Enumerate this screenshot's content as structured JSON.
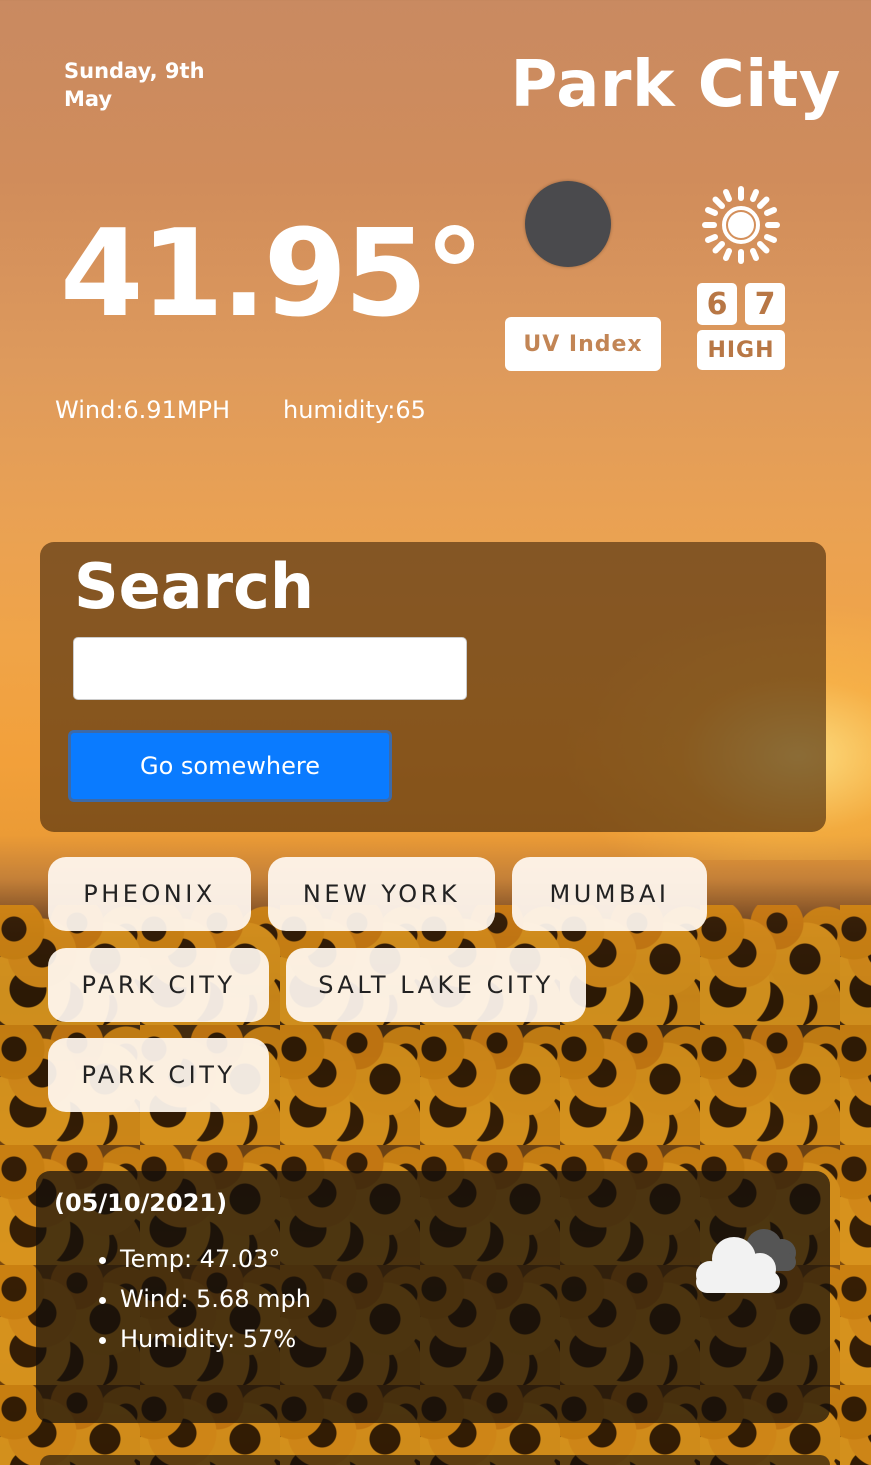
{
  "header": {
    "date": "Sunday, 9th May",
    "city": "Park City"
  },
  "current": {
    "temperature": "41.95°",
    "wind": "Wind:6.91MPH",
    "humidity": "humidity:65",
    "uv_label": "UV Index",
    "uv_digit_1": "6",
    "uv_digit_2": "7",
    "uv_level": "HIGH"
  },
  "search": {
    "title": "Search",
    "input_value": "",
    "button_label": "Go somewhere"
  },
  "history": [
    "PHEONIX",
    "NEW YORK",
    "MUMBAI",
    "PARK CITY",
    "SALT LAKE CITY",
    "PARK CITY"
  ],
  "forecast": {
    "date": "(05/10/2021)",
    "temp": "Temp: 47.03°",
    "wind": "Wind: 5.68 mph",
    "humidity": "Humidity: 57%"
  },
  "icons": {
    "moon": "moon-icon",
    "sun": "sun-icon",
    "cloud": "cloud-icon"
  }
}
